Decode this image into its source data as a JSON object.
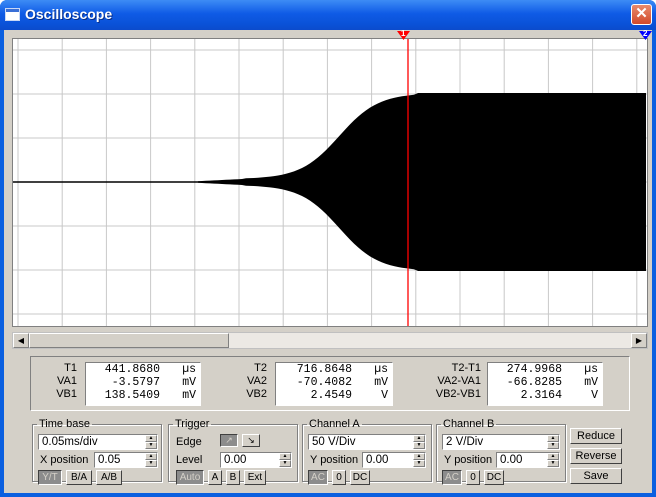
{
  "window": {
    "title": "Oscilloscope",
    "close_symbol": "✕"
  },
  "cursors": {
    "t1_marker": "1",
    "t2_marker": "2"
  },
  "readout": {
    "col1": {
      "labels": [
        "T1",
        "VA1",
        "VB1"
      ],
      "values": [
        {
          "num": "441.8680",
          "unit": "µs"
        },
        {
          "num": "-3.5797",
          "unit": "mV"
        },
        {
          "num": "138.5409",
          "unit": "mV"
        }
      ]
    },
    "col2": {
      "labels": [
        "T2",
        "VA2",
        "VB2"
      ],
      "values": [
        {
          "num": "716.8648",
          "unit": "µs"
        },
        {
          "num": "-70.4082",
          "unit": "mV"
        },
        {
          "num": "2.4549",
          "unit": "V"
        }
      ]
    },
    "col3": {
      "labels": [
        "T2-T1",
        "VA2-VA1",
        "VB2-VB1"
      ],
      "values": [
        {
          "num": "274.9968",
          "unit": "µs"
        },
        {
          "num": "-66.8285",
          "unit": "mV"
        },
        {
          "num": "2.3164",
          "unit": "V"
        }
      ]
    }
  },
  "timebase": {
    "legend": "Time base",
    "value": "0.05ms/div",
    "xpos_label": "X position",
    "xpos_value": "0.05",
    "buttons": [
      "Y/T",
      "B/A",
      "A/B"
    ]
  },
  "trigger": {
    "legend": "Trigger",
    "edge_label": "Edge",
    "edge_rise": "↗",
    "edge_fall": "↘",
    "level_label": "Level",
    "level_value": "0.00",
    "buttons": [
      "Auto",
      "A",
      "B",
      "Ext"
    ]
  },
  "channel_a": {
    "legend": "Channel A",
    "value": "50 V/Div",
    "ypos_label": "Y position",
    "ypos_value": "0.00",
    "buttons": [
      "AC",
      "0",
      "DC"
    ]
  },
  "channel_b": {
    "legend": "Channel B",
    "value": "2 V/Div",
    "ypos_label": "Y position",
    "ypos_value": "0.00",
    "buttons": [
      "AC",
      "0",
      "DC"
    ]
  },
  "side_buttons": {
    "reduce": "Reduce",
    "reverse": "Reverse",
    "save": "Save"
  },
  "colors": {
    "cursor1": "#ff0000",
    "cursor2": "#0000ff",
    "trace": "#000000",
    "grid": "#c8c8c8"
  }
}
